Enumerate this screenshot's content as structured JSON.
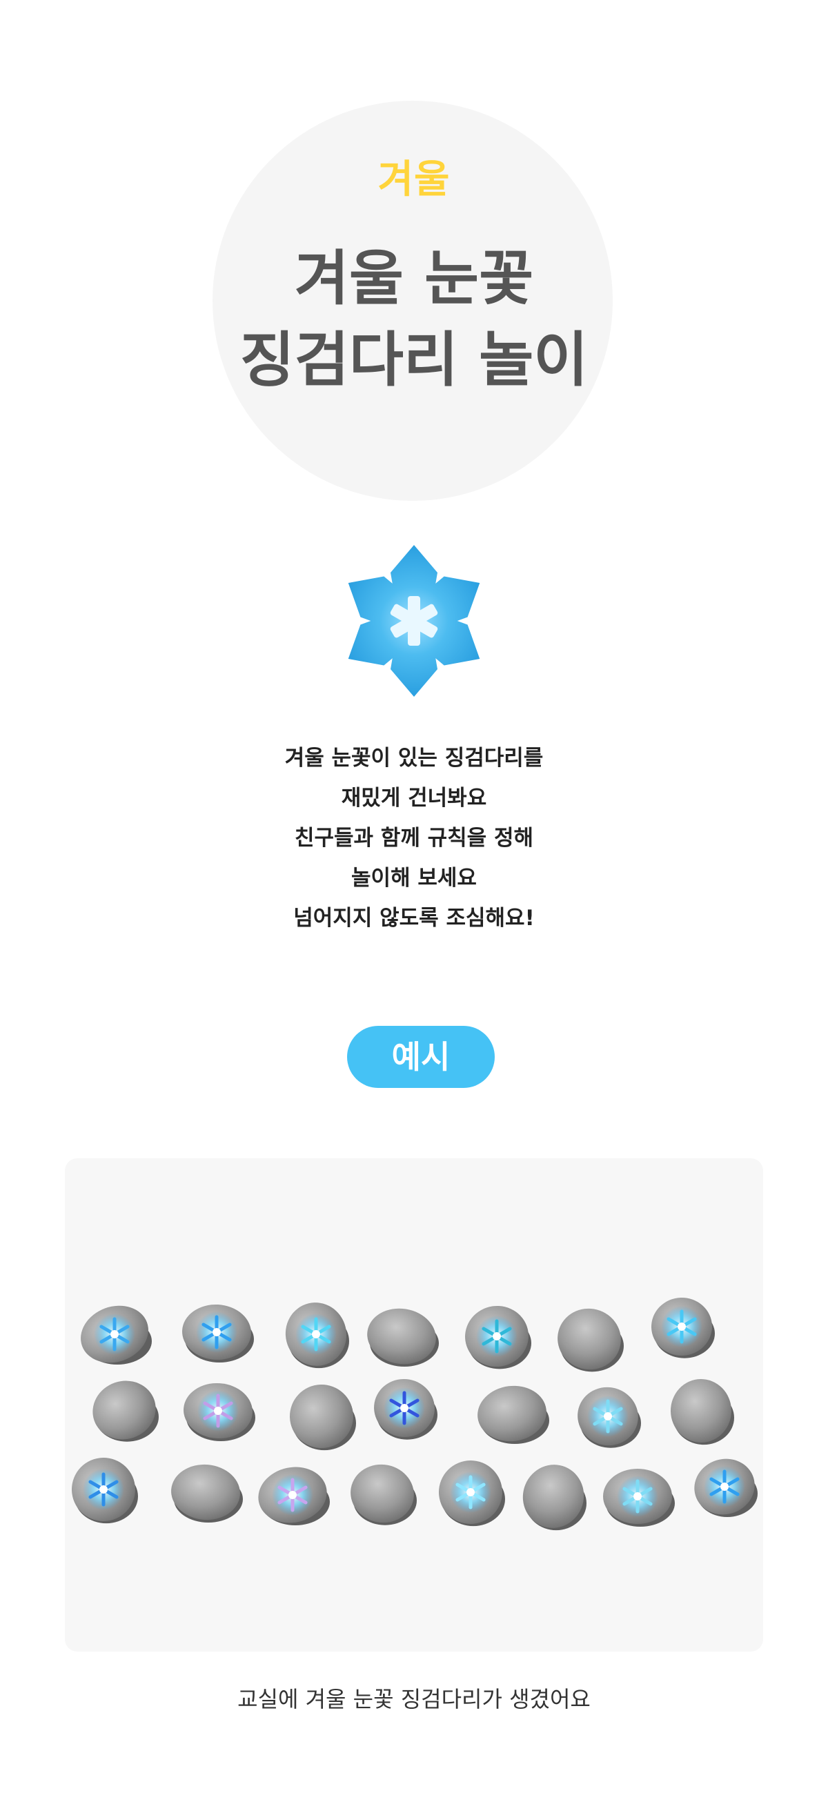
{
  "header": {
    "season": "겨울",
    "title_lines": [
      "겨울 눈꽃",
      "징검다리 놀이"
    ]
  },
  "icon": {
    "name": "snowflake-icon",
    "color": "#2ea8e5"
  },
  "description": {
    "lines": [
      "겨울 눈꽃이 있는 징검다리를",
      "재밌게 건너봐요",
      "친구들과 함께 규칙을 정해",
      "놀이해 보세요",
      "넘어지지 않도록 조심해요!"
    ]
  },
  "example": {
    "button_label": "예시",
    "caption": "교실에 겨울 눈꽃 징검다리가 생겼어요"
  },
  "colors": {
    "accent": "#45c2f5",
    "season_tag": "#ffd43b",
    "title": "#555555",
    "panel_bg": "#f7f7f7"
  }
}
